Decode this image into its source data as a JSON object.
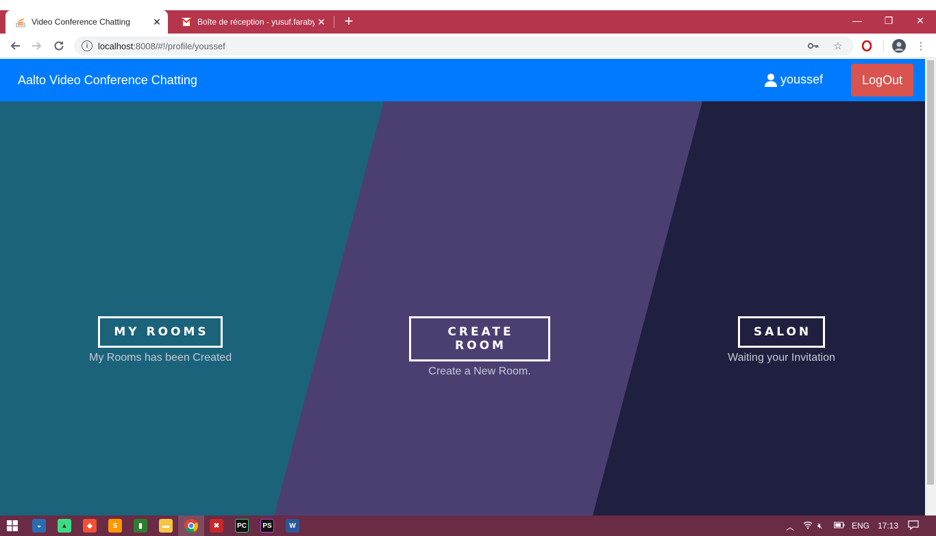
{
  "browser": {
    "tabs": [
      {
        "title": "Video Conference Chatting",
        "active": true,
        "icon": "stackoverflow-icon"
      },
      {
        "title": "Boîte de réception - yusuf.faraby",
        "active": false,
        "icon": "gmail-icon"
      }
    ],
    "url_host": "localhost",
    "url_path": ":8008/#!/profile/youssef"
  },
  "app": {
    "brand": "Aalto Video Conference Chatting",
    "username": "youssef",
    "logout_label": "LogOut"
  },
  "panels": [
    {
      "button": "MY ROOMS",
      "subtitle": "My Rooms has been Created",
      "color": "#1b637b"
    },
    {
      "button": "CREATE ROOM",
      "subtitle": "Create a New Room.",
      "color": "#4b3f72"
    },
    {
      "button": "SALON",
      "subtitle": "Waiting your Invitation",
      "color": "#1f1f3f"
    }
  ],
  "taskbar": {
    "lang": "ENG",
    "time": "17:13"
  },
  "colors": {
    "navbar": "#007bff",
    "logout": "#d9534f",
    "tabstrip": "#b5354c",
    "taskbar": "#6a2b44"
  }
}
